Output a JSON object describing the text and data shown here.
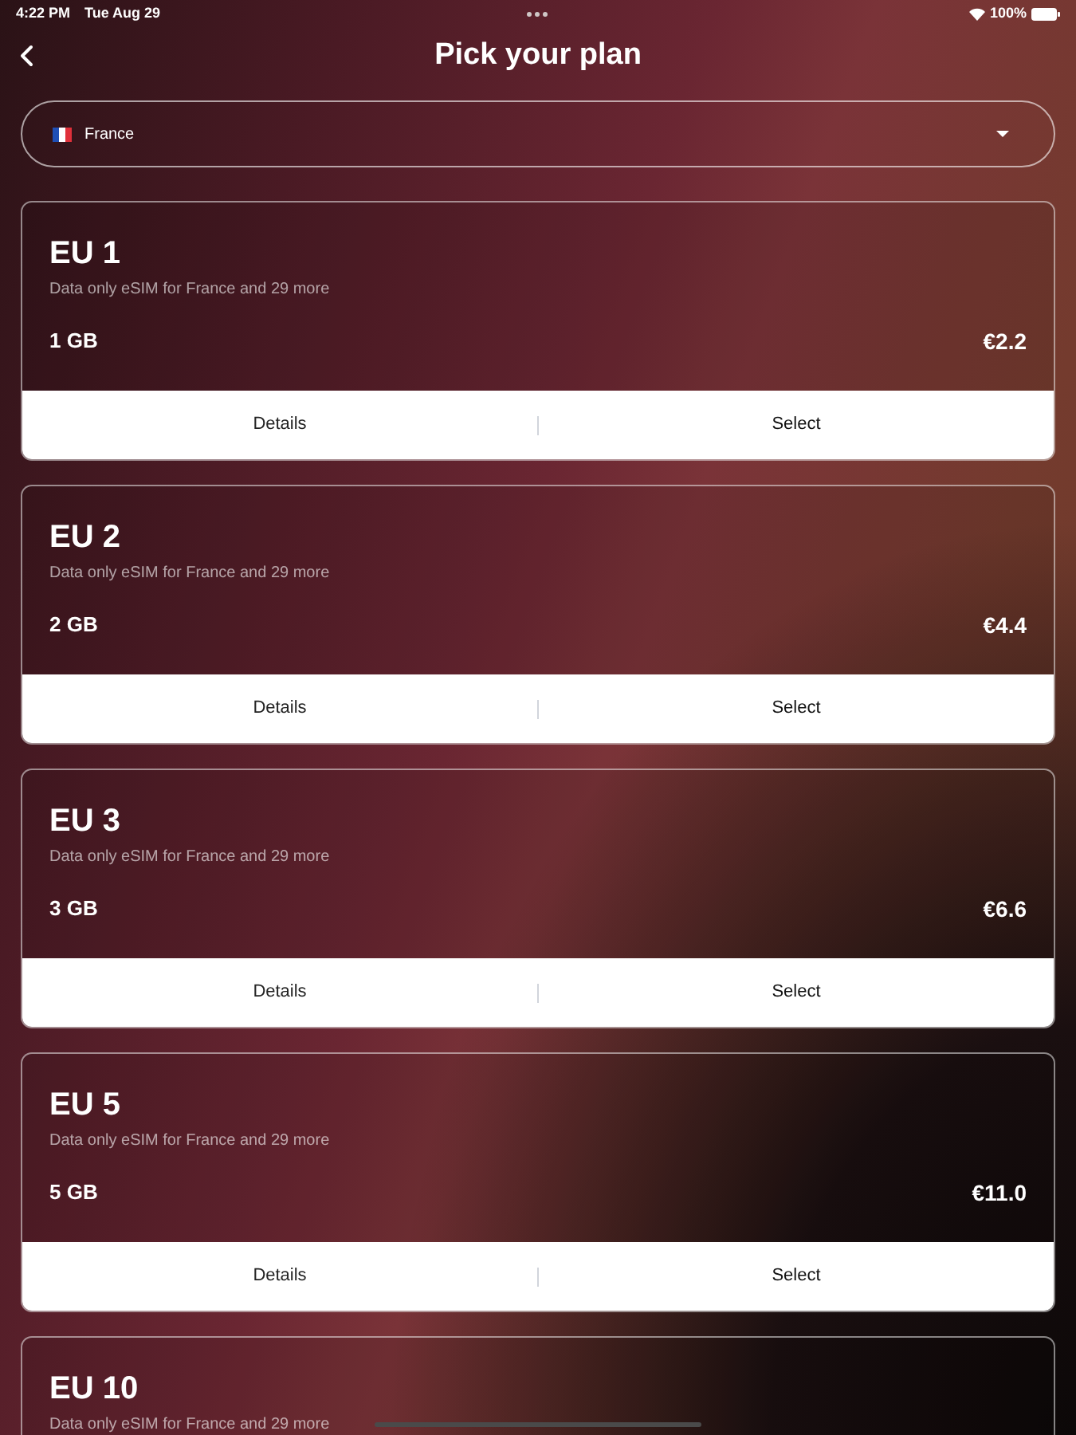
{
  "status_bar": {
    "time": "4:22 PM",
    "date": "Tue Aug 29",
    "battery": "100%"
  },
  "header": {
    "title": "Pick your plan"
  },
  "country_select": {
    "value": "France"
  },
  "plans": [
    {
      "name": "EU 1",
      "description": "Data only eSIM for France and 29 more",
      "data": "1 GB",
      "price": "€2.2",
      "details_label": "Details",
      "select_label": "Select"
    },
    {
      "name": "EU 2",
      "description": "Data only eSIM for France and 29 more",
      "data": "2 GB",
      "price": "€4.4",
      "details_label": "Details",
      "select_label": "Select"
    },
    {
      "name": "EU 3",
      "description": "Data only eSIM for France and 29 more",
      "data": "3 GB",
      "price": "€6.6",
      "details_label": "Details",
      "select_label": "Select"
    },
    {
      "name": "EU 5",
      "description": "Data only eSIM for France and 29 more",
      "data": "5 GB",
      "price": "€11.0",
      "details_label": "Details",
      "select_label": "Select"
    },
    {
      "name": "EU 10",
      "description": "Data only eSIM for France and 29 more"
    }
  ]
}
